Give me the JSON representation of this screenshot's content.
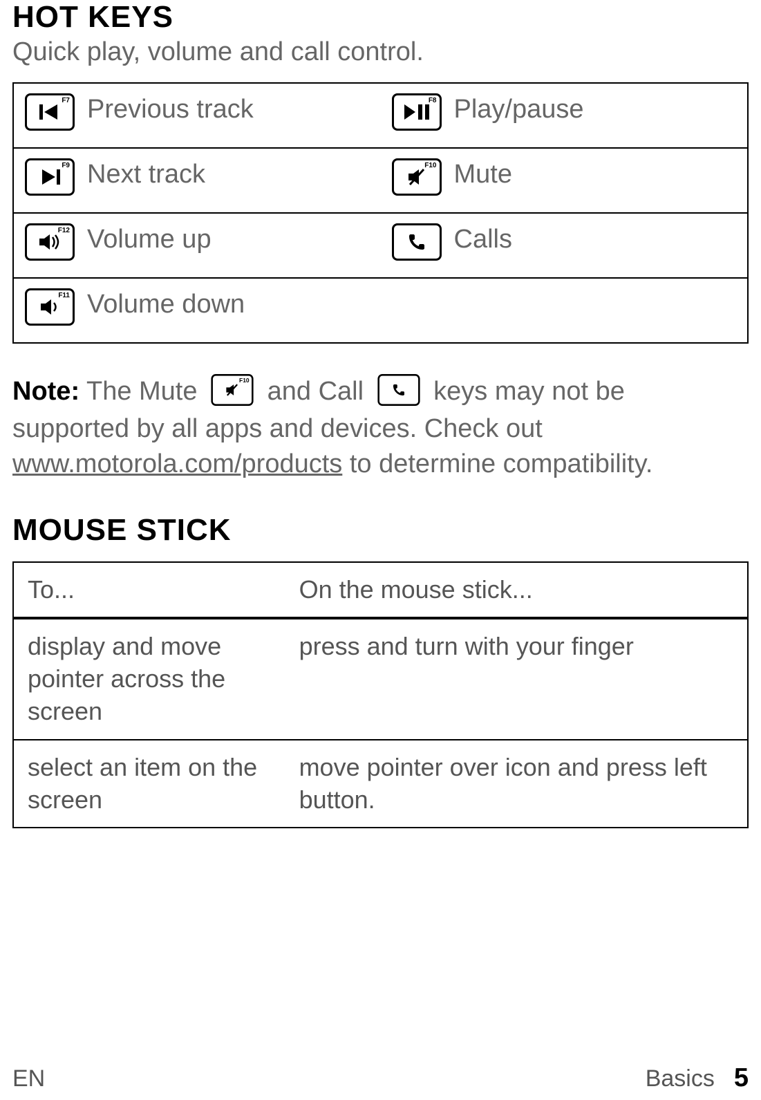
{
  "hotkeys": {
    "title": "HOT KEYS",
    "subtitle": "Quick play, volume and call control.",
    "rows": [
      {
        "left": {
          "fn": "F7",
          "label": "Previous track"
        },
        "right": {
          "fn": "F8",
          "label": "Play/pause"
        }
      },
      {
        "left": {
          "fn": "F9",
          "label": "Next track"
        },
        "right": {
          "fn": "F10",
          "label": "Mute"
        }
      },
      {
        "left": {
          "fn": "F12",
          "label": "Volume up"
        },
        "right": {
          "fn": "",
          "label": "Calls"
        }
      },
      {
        "left": {
          "fn": "F11",
          "label": "Volume down"
        }
      }
    ]
  },
  "note": {
    "label": "Note:",
    "text1": " The Mute ",
    "mute_fn": "F10",
    "text2": " and Call ",
    "text3": " keys may not be supported by all apps and devices. Check out ",
    "link": "www.motorola.com/products",
    "text4": " to determine compatibility."
  },
  "mouse": {
    "title": "MOUSE STICK",
    "header": {
      "col1": "To...",
      "col2": "On the mouse stick..."
    },
    "rows": [
      {
        "col1": "display and move pointer across the screen",
        "col2": "press and turn with your finger"
      },
      {
        "col1": "select an item on the screen",
        "col2": "move pointer over icon and press left button."
      }
    ]
  },
  "footer": {
    "left": "EN",
    "section": "Basics",
    "page": "5"
  }
}
